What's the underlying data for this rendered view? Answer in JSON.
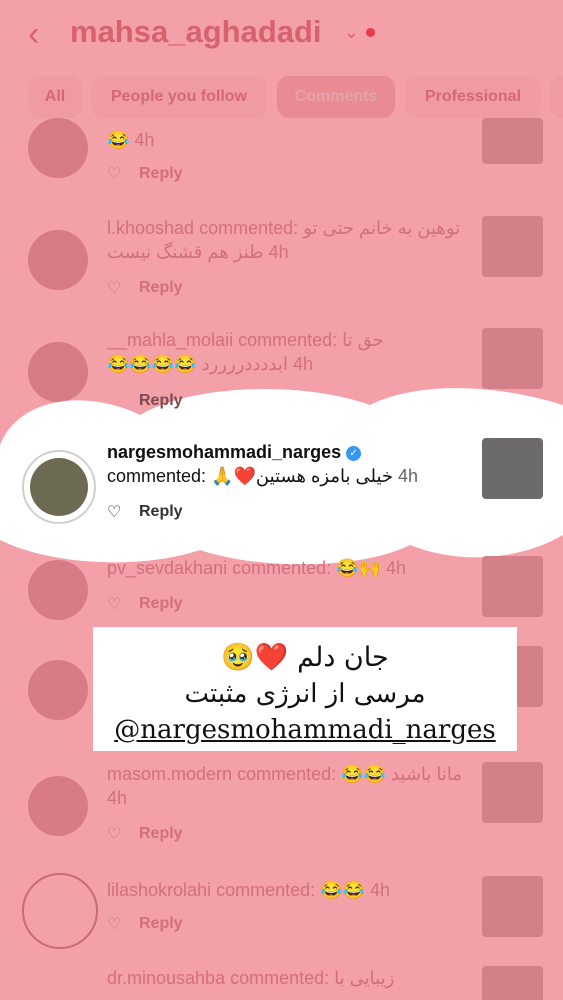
{
  "header": {
    "username": "mahsa_aghadadi"
  },
  "tabs": [
    "All",
    "People you follow",
    "Comments",
    "Professional"
  ],
  "comments": [
    {
      "user": "",
      "text": "😂 4h",
      "reply": "Reply"
    },
    {
      "user": "l.khooshad",
      "verb": "commented:",
      "text_rtl": "توهین به خانم حتی تو طنز هم قشنگ نیست",
      "time": "4h",
      "reply": "Reply"
    },
    {
      "user": "__mahla_molaii",
      "verb": "commented:",
      "text_rtl": "حق تا ابددددررررد 😂😂😂😂",
      "time": "4h",
      "reply": "Reply"
    },
    {
      "user": "nargesmohammadi_narges",
      "verb": "commented:",
      "text_rtl": "خیلی بامزه هستین❤️🙏",
      "time": "4h",
      "reply": "Reply"
    },
    {
      "user": "pv_sevdakhani",
      "verb": "commented:",
      "text": "😂🙌",
      "time": "4h",
      "reply": "Reply"
    },
    {
      "user": "masom.modern",
      "verb": "commented:",
      "text_rtl": "مانا باشید 😂😂",
      "time": "4h",
      "reply": "Reply"
    },
    {
      "user": "lilashokrolahi",
      "verb": "commented:",
      "text": "😂😂",
      "time": "4h",
      "reply": "Reply"
    },
    {
      "user": "dr.minousahba",
      "verb": "commented:",
      "text_rtl": "زیبایی با",
      "time": "",
      "reply": ""
    }
  ],
  "banner": {
    "line1": "جان دلم ❤️🥹",
    "line2": "مرسی از انرژی مثبتت",
    "line3": "@nargesmohammadi_narges"
  },
  "colors": {
    "overlay": "#f3a0a8",
    "accent": "#d7616f",
    "verified": "#3897f0"
  },
  "icons": [
    "back-chevron-icon",
    "dropdown-chevron-icon",
    "heart-icon",
    "verified-badge-icon"
  ]
}
